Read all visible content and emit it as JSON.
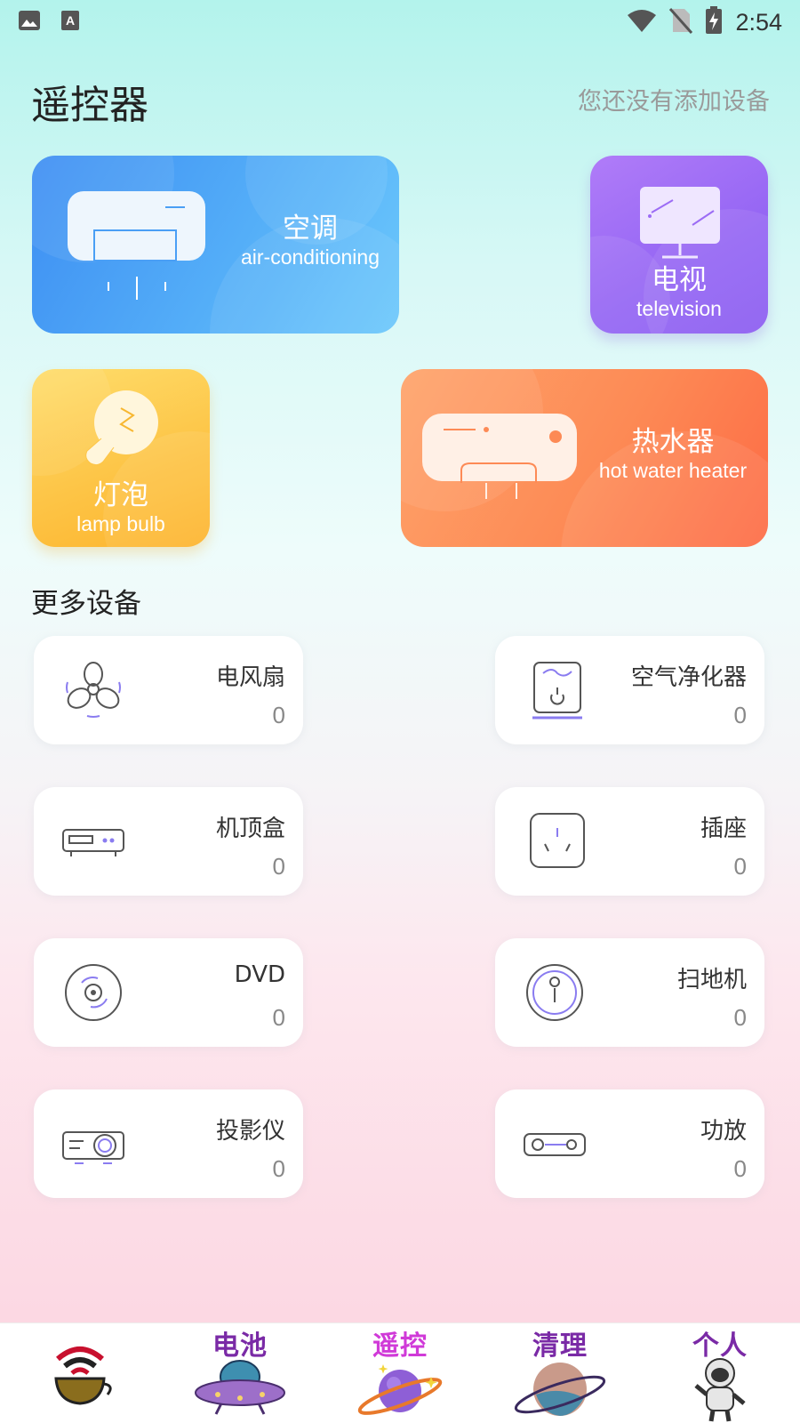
{
  "status_bar": {
    "time": "2:54"
  },
  "header": {
    "title": "遥控器",
    "hint": "您还没有添加设备"
  },
  "featured": [
    {
      "id": "ac",
      "cn": "空调",
      "en": "air-conditioning"
    },
    {
      "id": "tv",
      "cn": "电视",
      "en": "television"
    },
    {
      "id": "lamp",
      "cn": "灯泡",
      "en": "lamp bulb"
    },
    {
      "id": "heater",
      "cn": "热水器",
      "en": "hot water heater"
    }
  ],
  "more_section": {
    "title": "更多设备"
  },
  "devices": [
    {
      "name": "电风扇",
      "count": "0",
      "icon": "fan-icon"
    },
    {
      "name": "空气净化器",
      "count": "0",
      "icon": "air-purifier-icon"
    },
    {
      "name": "机顶盒",
      "count": "0",
      "icon": "set-top-box-icon"
    },
    {
      "name": "插座",
      "count": "0",
      "icon": "socket-icon"
    },
    {
      "name": "DVD",
      "count": "0",
      "icon": "dvd-icon"
    },
    {
      "name": "扫地机",
      "count": "0",
      "icon": "robot-vacuum-icon"
    },
    {
      "name": "投影仪",
      "count": "0",
      "icon": "projector-icon"
    },
    {
      "name": "功放",
      "count": "0",
      "icon": "amplifier-icon"
    }
  ],
  "bottom_nav": [
    {
      "label": "",
      "icon": "wifi-coffee-icon"
    },
    {
      "label": "电池",
      "icon": "ufo-icon"
    },
    {
      "label": "遥控",
      "icon": "planet-icon",
      "active": true
    },
    {
      "label": "清理",
      "icon": "planet-ring-icon"
    },
    {
      "label": "个人",
      "icon": "astronaut-icon"
    }
  ],
  "colors": {
    "ac_card": "#4a9ff5",
    "tv_card": "#9c6cf5",
    "lamp_card": "#fdc547",
    "heater_card": "#fd8a55",
    "nav_label": "#7a2aa6",
    "nav_label_active": "#d03ad8"
  }
}
